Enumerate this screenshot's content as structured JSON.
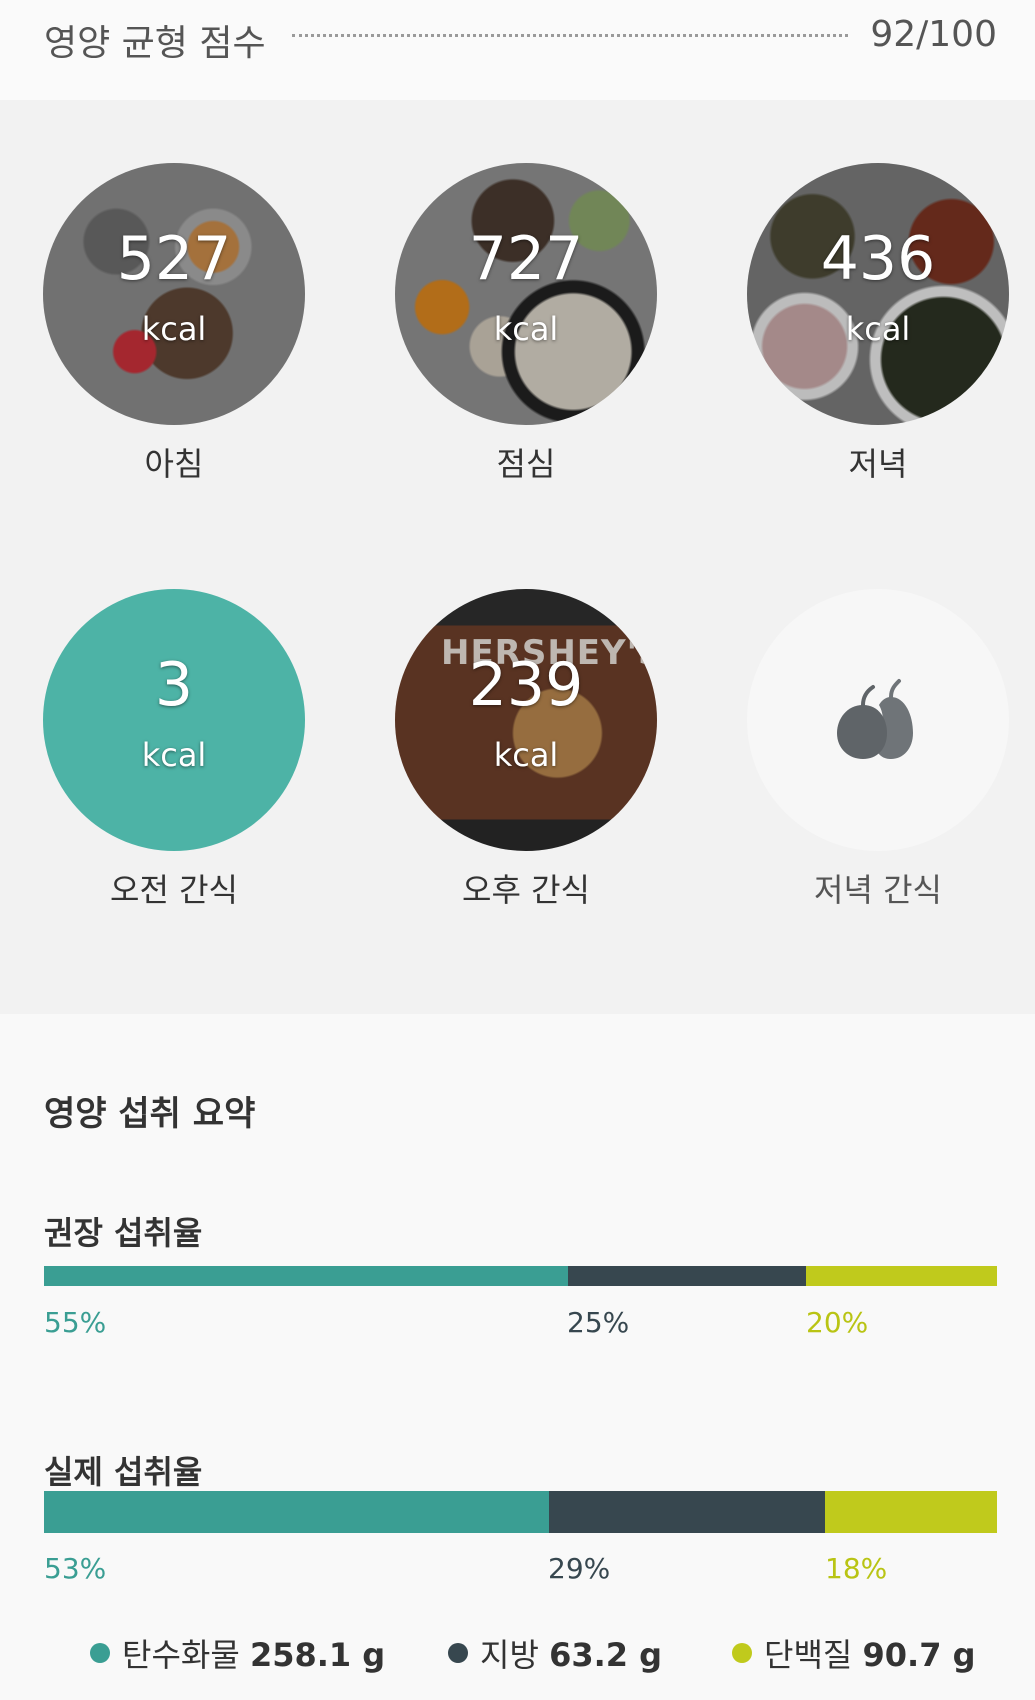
{
  "score": {
    "label": "영양 균형 점수",
    "value": "92/100"
  },
  "meals": [
    {
      "kcal": "527",
      "unit": "kcal",
      "label": "아침"
    },
    {
      "kcal": "727",
      "unit": "kcal",
      "label": "점심"
    },
    {
      "kcal": "436",
      "unit": "kcal",
      "label": "저녁"
    },
    {
      "kcal": "3",
      "unit": "kcal",
      "label": "오전 간식"
    },
    {
      "kcal": "239",
      "unit": "kcal",
      "label": "오후 간식",
      "photo_text": "HERSHEY'S"
    },
    {
      "label": "저녁 간식",
      "icon": "fruit-icon"
    }
  ],
  "summary": {
    "title": "영양 섭취 요약",
    "recommended": {
      "title": "권장 섭취율",
      "carb": "55%",
      "fat": "25%",
      "protein": "20%",
      "values": [
        55,
        25,
        20
      ]
    },
    "actual": {
      "title": "실제 섭취율",
      "carb": "53%",
      "fat": "29%",
      "protein": "18%",
      "values": [
        53,
        29,
        18
      ]
    },
    "legend": [
      {
        "name": "탄수화물",
        "value": "258.1 g"
      },
      {
        "name": "지방",
        "value": "63.2 g"
      },
      {
        "name": "단백질",
        "value": "90.7 g"
      }
    ]
  },
  "colors": {
    "carb": "#3a9e93",
    "fat": "#37474f",
    "protein": "#c0ca1c",
    "teal": "#4db3a6"
  }
}
